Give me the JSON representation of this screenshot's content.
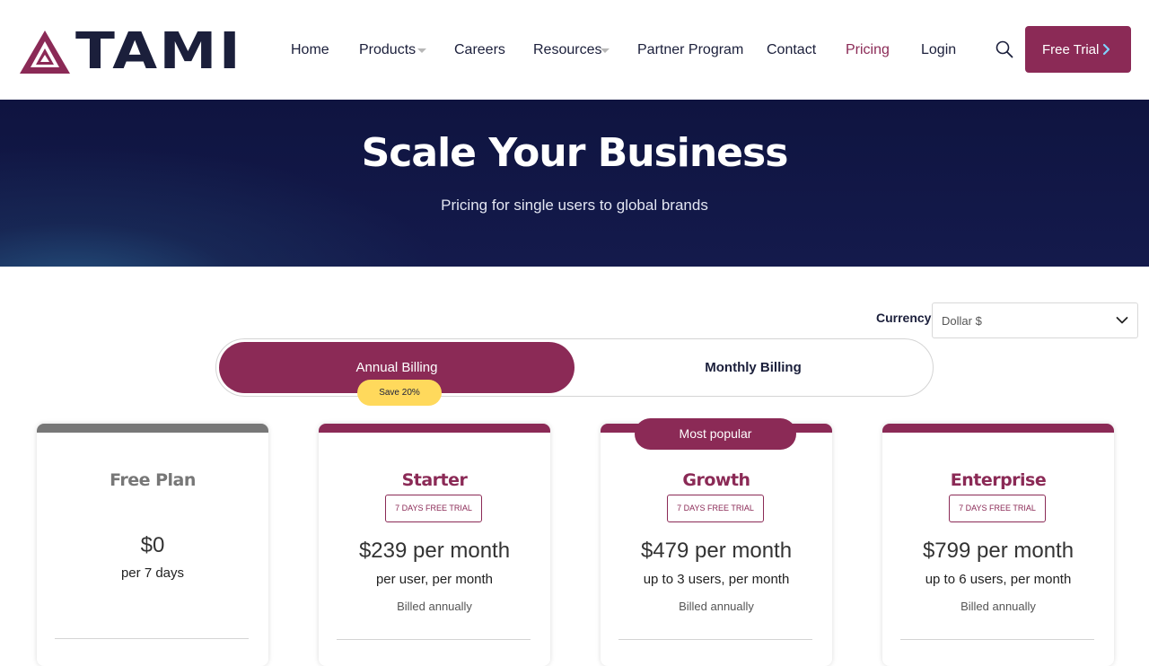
{
  "header": {
    "logo_text": "TAMI",
    "nav": [
      {
        "label": "Home"
      },
      {
        "label": "Products"
      },
      {
        "label": "Careers"
      },
      {
        "label": "Resources"
      },
      {
        "label": "Partner Program"
      },
      {
        "label": "Contact"
      },
      {
        "label": "Pricing"
      },
      {
        "label": "Login"
      }
    ],
    "cta_label": "Free Trial"
  },
  "hero": {
    "title": "Scale Your Business",
    "subtitle": "Pricing for single users to global brands"
  },
  "currency": {
    "label": "Currency:",
    "selected": "Dollar $"
  },
  "billing": {
    "annual_label": "Annual Billing",
    "monthly_label": "Monthly Billing",
    "save_label": "Save 20%",
    "selected": "Annual Billing"
  },
  "plans": [
    {
      "name": "Free Plan",
      "price": "$0",
      "note": "per 7 days"
    },
    {
      "name": "Starter",
      "trial": "7 DAYS FREE TRIAL",
      "price": "$239 per month",
      "note": "per user, per month",
      "billed": "Billed annually"
    },
    {
      "name": "Growth",
      "trial": "7 DAYS FREE TRIAL",
      "price": "$479 per month",
      "note": "up to 3 users, per month",
      "billed": "Billed annually",
      "badge": "Most popular"
    },
    {
      "name": "Enterprise",
      "trial": "7 DAYS FREE TRIAL",
      "price": "$799 per month",
      "note": "up to 6 users, per month",
      "billed": "Billed annually"
    }
  ],
  "colors": {
    "brand": "#8b2a56",
    "navy": "#1b1f3b",
    "hero_bg": "#131a4a",
    "badge_yellow": "#ffd95c"
  },
  "icons": {
    "search": "search-icon",
    "dropdown": "chevron-down-icon",
    "cta": "chevron-right-icon"
  }
}
